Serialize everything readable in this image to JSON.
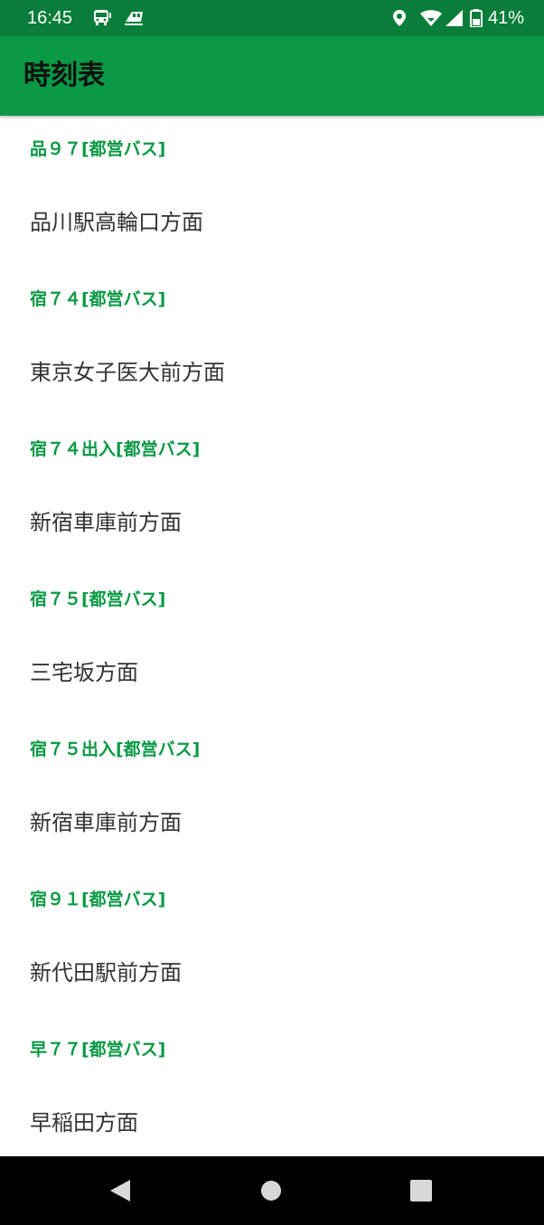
{
  "status_bar": {
    "time": "16:45",
    "battery": "41%",
    "icons": [
      "bus-icon",
      "train-icon",
      "location-icon",
      "wifi-icon",
      "signal-icon",
      "battery-icon"
    ],
    "background": "#097d3a"
  },
  "app_bar": {
    "title": "時刻表",
    "background": "#0a9944"
  },
  "routes": [
    {
      "route": "品９７[都営バス]",
      "direction": "品川駅高輪口方面"
    },
    {
      "route": "宿７４[都営バス]",
      "direction": "東京女子医大前方面"
    },
    {
      "route": "宿７４出入[都営バス]",
      "direction": "新宿車庫前方面"
    },
    {
      "route": "宿７５[都営バス]",
      "direction": "三宅坂方面"
    },
    {
      "route": "宿７５出入[都営バス]",
      "direction": "新宿車庫前方面"
    },
    {
      "route": "宿９１[都営バス]",
      "direction": "新代田駅前方面"
    },
    {
      "route": "早７７[都営バス]",
      "direction": "早稲田方面"
    }
  ],
  "nav_bar": {
    "icons": [
      "back-icon",
      "home-icon",
      "recents-icon"
    ]
  }
}
